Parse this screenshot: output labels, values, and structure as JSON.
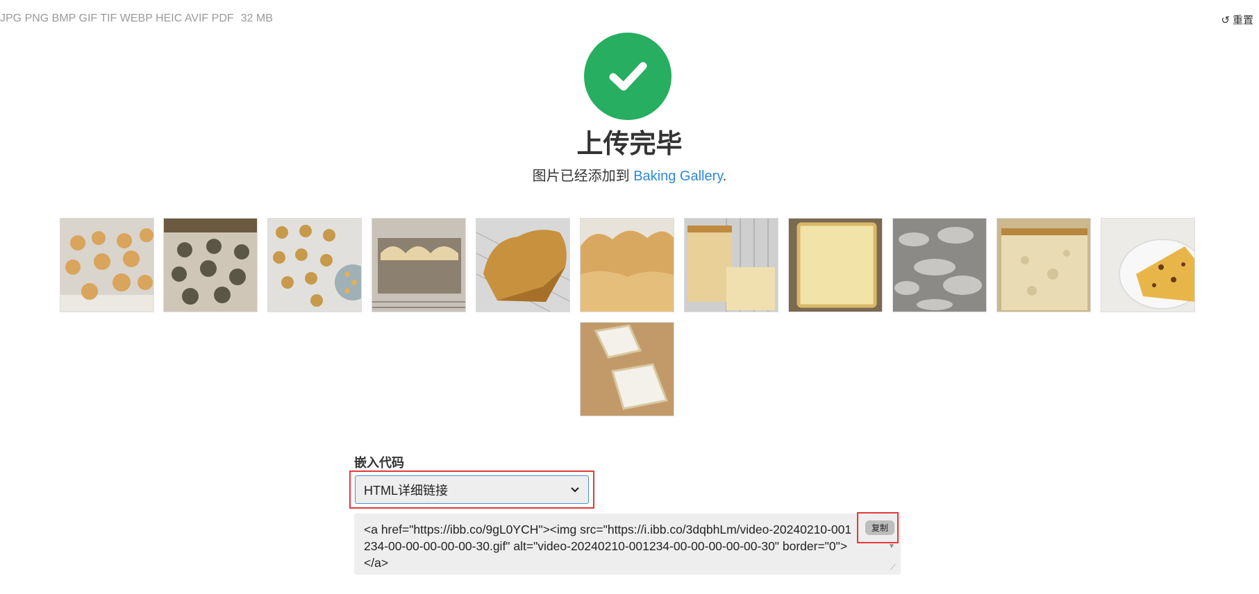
{
  "header": {
    "formats": "JPG PNG BMP GIF TIF WEBP HEIC AVIF PDF",
    "max_size": "32 MB",
    "reset_label": "重置"
  },
  "status": {
    "title": "上传完毕",
    "subtitle_prefix": "图片已经添加到 ",
    "album_link": "Baking Gallery",
    "subtitle_suffix": "."
  },
  "thumbnails": [
    {
      "name": "dough-balls-tray"
    },
    {
      "name": "coated-dough-balls"
    },
    {
      "name": "sesame-cookies-tray"
    },
    {
      "name": "bread-in-loaf-pan"
    },
    {
      "name": "golden-loaf-on-rack"
    },
    {
      "name": "tall-loaf"
    },
    {
      "name": "sliced-bread-on-rack"
    },
    {
      "name": "bread-slice-closeup"
    },
    {
      "name": "crumb-texture"
    },
    {
      "name": "bread-crumb-interior"
    },
    {
      "name": "cake-on-plate"
    },
    {
      "name": "bread-slices-on-board"
    }
  ],
  "embed": {
    "label": "嵌入代码",
    "selected_option": "HTML详细链接",
    "code": "<a href=\"https://ibb.co/9gL0YCH\"><img src=\"https://i.ibb.co/3dqbhLm/video-20240210-001234-00-00-00-00-00-30.gif\" alt=\"video-20240210-001234-00-00-00-00-00-30\" border=\"0\"></a>",
    "copy_label": "复制"
  }
}
